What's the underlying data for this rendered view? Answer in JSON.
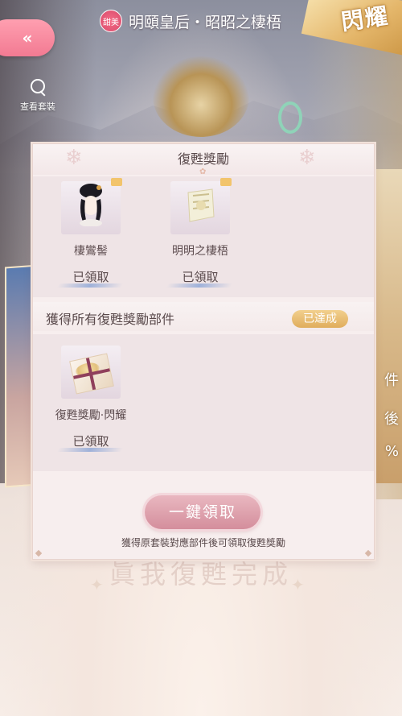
{
  "header": {
    "back_label": "«",
    "quality_tag": "甜美",
    "title": "明頤皇后・昭昭之棲梧",
    "flash_badge": "閃耀"
  },
  "side": {
    "view_outfit_label": "查看套裝",
    "right_edge_text": [
      "件",
      "後",
      "%"
    ]
  },
  "modal": {
    "title": "復甦獎勵",
    "top_items": [
      {
        "name": "棲鸞髻",
        "status": "已領取",
        "icon": "hairstyle-icon"
      },
      {
        "name": "明明之棲梧",
        "status": "已領取",
        "icon": "outfit-piece-icon"
      }
    ],
    "achievement": {
      "title": "獲得所有復甦獎勵部件",
      "badge": "已達成"
    },
    "bottom_items": [
      {
        "name": "復甦獎勵·閃耀",
        "status": "已領取",
        "icon": "gift-box-icon"
      }
    ],
    "claim_all_label": "一鍵領取",
    "hint": "獲得原套裝對應部件後可領取復甦獎勵"
  },
  "background_phrase": "眞我復甦完成"
}
